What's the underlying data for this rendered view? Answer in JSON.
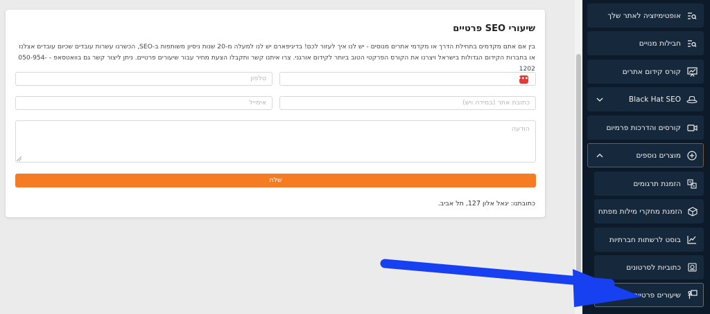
{
  "card": {
    "title": "שיעורי SEO פרטיים",
    "description": "בין אם אתם מקדמים בתחילת הדרך או מקדמי אתרים מנוסים - יש לנו איך לעזור לכם! בדיגיפארם יש לנו למעלה מ-20 שנות ניסיון משותפות ב-SEO, הכשרנו עשרות עובדים שכיום עובדים אצלנו או בחברות הקידום הגדולות בישראל ויצרנו את הקורס הפרקטי הטוב ביותר לקידום אורגני. צרו איתנו קשר ותקבלו הצעת מחיר עבור שיעורים פרטיים. ניתן ליצור קשר גם בוואטסאפ - 050-954-1202",
    "form": {
      "name_placeholder": "",
      "phone_placeholder": "טלפון",
      "website_placeholder": "כתובת אתר (במידה ויש)",
      "email_placeholder": "אימייל",
      "message_placeholder": "הודעה",
      "badge_text": "•••",
      "submit_label": "שלח"
    },
    "address": "כתובתנו: יגאל אלון 127, תל אביב."
  },
  "sidebar": {
    "items": [
      {
        "label": "אופטימיזציה לאתר שלך",
        "icon": "search-list-icon"
      },
      {
        "label": "חבילות מנויים",
        "icon": "search-list-icon"
      },
      {
        "label": "קורס קידום אתרים",
        "icon": "presentation-icon"
      },
      {
        "label": "Black Hat SEO",
        "icon": "hat-icon",
        "chevron": "down"
      },
      {
        "label": "קורסים והדרכות פרמיום",
        "icon": "video-icon"
      },
      {
        "label": "מוצרים נוספים",
        "icon": "plus-circle-icon",
        "chevron": "up"
      }
    ],
    "subitems": [
      {
        "label": "הזמנת תרגומים",
        "icon": "translate-icon"
      },
      {
        "label": "הזמנת מחקרי מילות מפתח",
        "icon": "box-icon"
      },
      {
        "label": "בוסט לרשתות חברתיות",
        "icon": "chart-line-icon"
      },
      {
        "label": "כתוביות לסרטונים",
        "icon": "subtitles-icon"
      },
      {
        "label": "שיעורים פרטיים",
        "icon": "teacher-icon"
      }
    ]
  },
  "colors": {
    "accent": "#f57c22",
    "sidebar_bg": "#0c1a29",
    "sidebar_item_bg": "#16283b",
    "arrow": "#1741f0"
  }
}
